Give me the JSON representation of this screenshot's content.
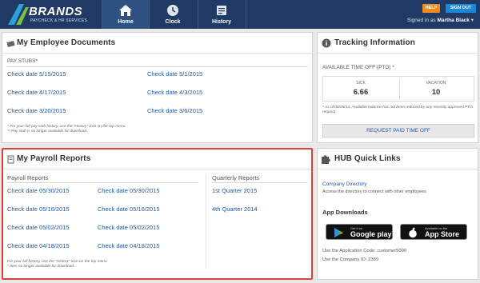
{
  "brand": {
    "name": "BRANDS",
    "tagline": "PAYCHECK & HR SERVICES"
  },
  "nav": {
    "tabs": [
      {
        "label": "Home",
        "icon": "home-icon",
        "active": true
      },
      {
        "label": "Clock",
        "icon": "clock-icon",
        "active": false
      },
      {
        "label": "History",
        "icon": "history-icon",
        "active": false
      }
    ],
    "help_label": "HELP",
    "signout_label": "SIGN OUT",
    "signed_in_prefix": "Signed in as",
    "user_name": "Martha Black"
  },
  "documents": {
    "title": "My Employee Documents",
    "section_label": "PAY STUBS*",
    "stubs": [
      "Check date 5/15/2015",
      "Check date 5/1/2015",
      "Check date 4/17/2015",
      "Check date 4/3/2015",
      "Check date 3/20/2015",
      "Check date 3/6/2015"
    ],
    "note1": "* For your full pay stub history, use the \"History\" icon on the top menu.",
    "note2": "** Pay stub is no longer available for download."
  },
  "payroll": {
    "title": "My Payroll Reports",
    "payroll_label": "Payroll Reports",
    "quarterly_label": "Quarterly Reports",
    "payroll_items": [
      "Check date 05/30/2015",
      "Check date 05/30/2015",
      "Check date 05/16/2015",
      "Check date 05/16/2015",
      "Check date 05/02/2015",
      "Check date 05/02/2015",
      "Check date 04/18/2015",
      "Check date 04/18/2015"
    ],
    "quarterly_items": [
      "1st Quarter 2015",
      "4th Quarter 2014"
    ],
    "note1": "For your full history, use the \"History\" icon on the top menu.",
    "note2": "* Item no longer available for download."
  },
  "tracking": {
    "title": "Tracking Information",
    "pto_label": "AVAILABLE TIME OFF (PTO) *",
    "sick_label": "SICK",
    "sick_value": "6.66",
    "vacation_label": "VACATION",
    "vacation_value": "10",
    "note": "* As of 06/09/14. Available balance has not been reduced by any recently approved PTO request.",
    "request_label": "REQUEST PAID TIME OFF"
  },
  "hub": {
    "title": "HUB Quick Links",
    "directory_link": "Company Directory",
    "directory_desc": "Access the directory to connect with other employees",
    "app_heading": "App Downloads",
    "google_small": "Get it on",
    "google_big": "Google play",
    "apple_small": "Available on the",
    "apple_big": "App Store",
    "app_code": "Use the Application Code: customer5000",
    "company_id": "Use the Company ID: 2389"
  },
  "colors": {
    "nav_bg": "#1f3a64",
    "link": "#2357a8",
    "highlight": "#d9413a",
    "help": "#f08a1c",
    "signout": "#1d86d6"
  }
}
